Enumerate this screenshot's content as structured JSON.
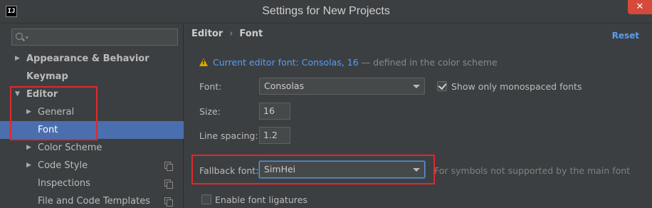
{
  "window": {
    "title": "Settings for New Projects",
    "app_icon_text": "IJ",
    "close_label": "✕"
  },
  "sidebar": {
    "search_placeholder": "",
    "items": [
      {
        "label": "Appearance & Behavior",
        "bold": true,
        "expandable": true,
        "expanded": false
      },
      {
        "label": "Keymap",
        "bold": true
      },
      {
        "label": "Editor",
        "bold": true,
        "expandable": true,
        "expanded": true
      },
      {
        "label": "General",
        "expandable": true,
        "expanded": false
      },
      {
        "label": "Font",
        "selected": true
      },
      {
        "label": "Color Scheme",
        "expandable": true,
        "expanded": false
      },
      {
        "label": "Code Style",
        "expandable": true,
        "expanded": false,
        "project_icon": true
      },
      {
        "label": "Inspections",
        "project_icon": true
      },
      {
        "label": "File and Code Templates",
        "project_icon": true
      }
    ]
  },
  "breadcrumb": {
    "parent": "Editor",
    "separator": "›",
    "current": "Font"
  },
  "reset_label": "Reset",
  "warning": {
    "link_text": "Current editor font: Consolas, 16",
    "rest_text": " — defined in the color scheme"
  },
  "font": {
    "label": "Font:",
    "value": "Consolas",
    "monospaced_checked": true,
    "monospaced_label": "Show only monospaced fonts"
  },
  "size": {
    "label": "Size:",
    "value": "16"
  },
  "line_spacing": {
    "label": "Line spacing:",
    "value": "1.2"
  },
  "fallback": {
    "label": "Fallback font:",
    "value": "SimHei",
    "hint": "For symbols not supported by the main font"
  },
  "ligatures": {
    "checked": false,
    "label": "Enable font ligatures"
  },
  "colors": {
    "background": "#3c3f41",
    "selection": "#4b6eaf",
    "link": "#589df6",
    "highlight_box": "#e0282b",
    "close_button": "#d54a3a"
  }
}
